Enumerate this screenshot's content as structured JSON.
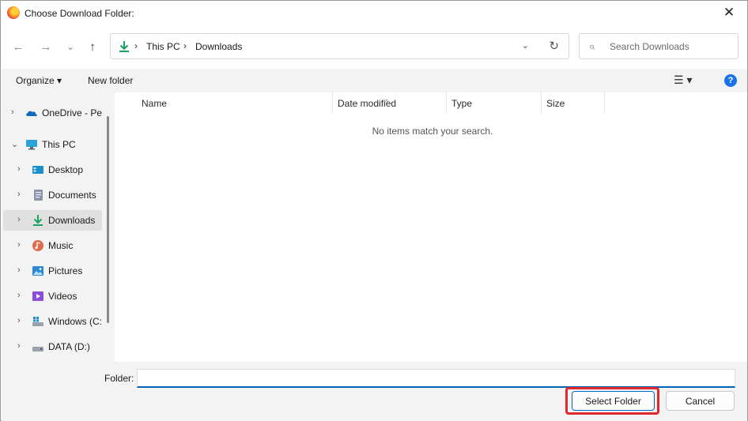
{
  "window": {
    "title": "Choose Download Folder:",
    "app_icon": "firefox-icon",
    "close_glyph": "✕"
  },
  "nav": {
    "back_icon": "←",
    "forward_icon": "→",
    "recent_icon": "⌄",
    "up_icon": "↑"
  },
  "address": {
    "icon": "downloads-icon",
    "crumbs": [
      "This PC",
      "Downloads"
    ],
    "separator": "›",
    "dropdown_icon": "⌄",
    "refresh_icon": "↻"
  },
  "search": {
    "placeholder": "Search Downloads",
    "icon": "⌕"
  },
  "toolbar": {
    "organize": "Organize ▾",
    "new_folder": "New folder",
    "view_icon": "☰ ▾",
    "help_icon": "?"
  },
  "sidebar": {
    "items": [
      {
        "label": "OneDrive - Per",
        "icon": "onedrive-icon",
        "expand": "›"
      },
      {
        "label": "This PC",
        "icon": "this-pc-icon",
        "expand": "⌄"
      },
      {
        "label": "Desktop",
        "icon": "desktop-icon",
        "expand": "›"
      },
      {
        "label": "Documents",
        "icon": "documents-icon",
        "expand": "›"
      },
      {
        "label": "Downloads",
        "icon": "downloads-icon",
        "expand": "›",
        "selected": true
      },
      {
        "label": "Music",
        "icon": "music-icon",
        "expand": "›"
      },
      {
        "label": "Pictures",
        "icon": "pictures-icon",
        "expand": "›"
      },
      {
        "label": "Videos",
        "icon": "videos-icon",
        "expand": "›"
      },
      {
        "label": "Windows (C:",
        "icon": "windows-drive-icon",
        "expand": "›"
      },
      {
        "label": "DATA (D:)",
        "icon": "data-drive-icon",
        "expand": "›"
      }
    ]
  },
  "columns": [
    "Name",
    "Date modified",
    "Type",
    "Size"
  ],
  "sort_indicator": "^",
  "empty_message": "No items match your search.",
  "footer": {
    "folder_label": "Folder:",
    "folder_value": "",
    "select_button": "Select Folder",
    "cancel_button": "Cancel"
  },
  "colors": {
    "accent": "#0063b1",
    "highlight": "#e0282e",
    "downloads_green": "#1aa260"
  }
}
